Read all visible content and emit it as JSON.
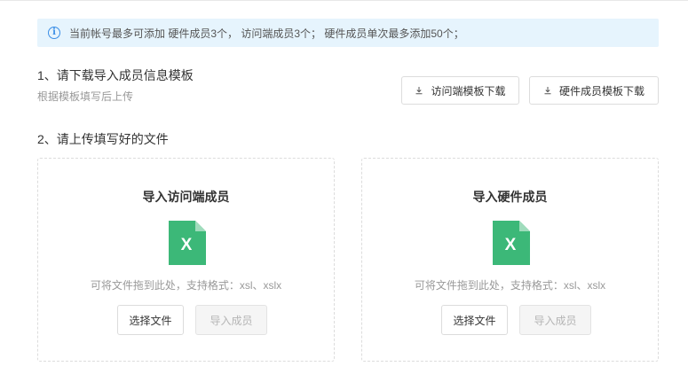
{
  "notice": {
    "icon": "info-icon",
    "text": "当前帐号最多可添加 硬件成员3个， 访问端成员3个； 硬件成员单次最多添加50个；"
  },
  "step1": {
    "title": "1、请下载导入成员信息模板",
    "subtitle": "根据模板填写后上传",
    "download_visitor_label": "访问端模板下载",
    "download_hardware_label": "硬件成员模板下载"
  },
  "step2": {
    "title": "2、请上传填写好的文件"
  },
  "panels": [
    {
      "title": "导入访问端成员",
      "icon": "excel-file-icon",
      "hint": "可将文件拖到此处，支持格式：xsl、xslx",
      "choose_label": "选择文件",
      "import_label": "导入成员"
    },
    {
      "title": "导入硬件成员",
      "icon": "excel-file-icon",
      "hint": "可将文件拖到此处，支持格式：xsl、xslx",
      "choose_label": "选择文件",
      "import_label": "导入成员"
    }
  ],
  "colors": {
    "notice_bg": "#e6f4fd",
    "info_blue": "#3a8ee6",
    "excel_green": "#3cb878"
  }
}
